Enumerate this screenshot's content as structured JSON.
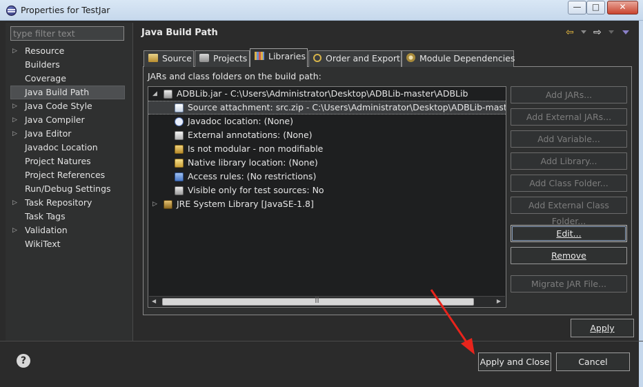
{
  "window": {
    "title": "Properties for TestJar",
    "minimize_glyph": "—",
    "maximize_glyph": "□",
    "close_glyph": "✕"
  },
  "sidebar": {
    "filter_placeholder": "type filter text",
    "items": [
      {
        "label": "Resource",
        "expandable": true
      },
      {
        "label": "Builders",
        "expandable": false
      },
      {
        "label": "Coverage",
        "expandable": false
      },
      {
        "label": "Java Build Path",
        "expandable": false,
        "selected": true
      },
      {
        "label": "Java Code Style",
        "expandable": true
      },
      {
        "label": "Java Compiler",
        "expandable": true
      },
      {
        "label": "Java Editor",
        "expandable": true
      },
      {
        "label": "Javadoc Location",
        "expandable": false
      },
      {
        "label": "Project Natures",
        "expandable": false
      },
      {
        "label": "Project References",
        "expandable": false
      },
      {
        "label": "Run/Debug Settings",
        "expandable": false
      },
      {
        "label": "Task Repository",
        "expandable": true
      },
      {
        "label": "Task Tags",
        "expandable": false
      },
      {
        "label": "Validation",
        "expandable": true
      },
      {
        "label": "WikiText",
        "expandable": false
      }
    ]
  },
  "page": {
    "title": "Java Build Path",
    "tabs": [
      {
        "label": "Source",
        "icon": "source-folder-icon"
      },
      {
        "label": "Projects",
        "icon": "projects-icon"
      },
      {
        "label": "Libraries",
        "icon": "libraries-icon",
        "active": true
      },
      {
        "label": "Order and Export",
        "icon": "order-export-icon"
      },
      {
        "label": "Module Dependencies",
        "icon": "module-icon"
      }
    ],
    "list_caption": "JARs and class folders on the build path:",
    "tree": [
      {
        "label": "ADBLib.jar - C:\\Users\\Administrator\\Desktop\\ADBLib-master\\ADBLib",
        "icon": "jar-icon",
        "twisty": "◢"
      },
      {
        "label": "Source attachment: src.zip - C:\\Users\\Administrator\\Desktop\\ADBLib-master\\ADBLib\\src.zip",
        "icon": "source-attachment-icon",
        "selected": true
      },
      {
        "label": "Javadoc location: (None)",
        "icon": "javadoc-icon"
      },
      {
        "label": "External annotations: (None)",
        "icon": "annotations-icon"
      },
      {
        "label": "Is not modular - non modifiable",
        "icon": "module-key-icon"
      },
      {
        "label": "Native library location: (None)",
        "icon": "native-library-icon"
      },
      {
        "label": "Access rules: (No restrictions)",
        "icon": "access-rules-icon"
      },
      {
        "label": "Visible only for test sources: No",
        "icon": "test-sources-icon"
      },
      {
        "label": "JRE System Library [JavaSE-1.8]",
        "icon": "jre-library-icon",
        "twisty": "▷"
      }
    ],
    "scroll_grip": "|||",
    "buttons": [
      {
        "label": "Add JARs...",
        "enabled": false
      },
      {
        "label": "Add External JARs...",
        "enabled": false
      },
      {
        "label": "Add Variable...",
        "enabled": false
      },
      {
        "label": "Add Library...",
        "enabled": false
      },
      {
        "label": "Add Class Folder...",
        "enabled": false
      },
      {
        "label": "Add External Class Folder...",
        "enabled": false
      },
      {
        "label": "Edit...",
        "enabled": true
      },
      {
        "label": "Remove",
        "enabled": true
      },
      {
        "label": "Migrate JAR File...",
        "enabled": false
      }
    ],
    "apply_label": "Apply"
  },
  "footer": {
    "help_glyph": "?",
    "apply_close_label": "Apply and Close",
    "cancel_label": "Cancel"
  },
  "colors": {
    "background": "#2b2b2b",
    "panel": "#2f3030",
    "tree_bg": "#1e1f20",
    "annotation_arrow": "#e8241c"
  }
}
